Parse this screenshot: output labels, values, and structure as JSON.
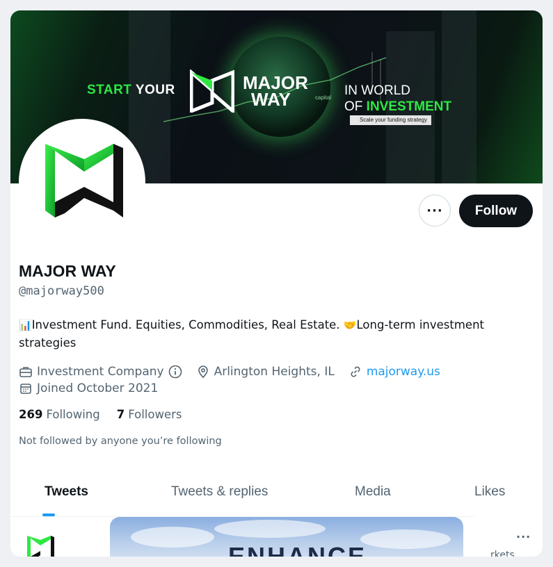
{
  "banner": {
    "start": "START",
    "your": " YOUR",
    "brand_line1": "MAJOR",
    "brand_line2": "WAY",
    "brand_small": "capital",
    "world_line1": "IN WORLD",
    "world_line2_a": "OF ",
    "world_line2_b": "INVESTMENT",
    "tagline": "Scale your funding strategy"
  },
  "actions": {
    "more_label": "···",
    "follow_label": "Follow"
  },
  "profile": {
    "display_name": "MAJOR WAY",
    "handle": "@majorway500",
    "bio_chart_emoji": "📊",
    "bio_part1": "Investment Fund. Equities, Commodities, Real Estate. ",
    "bio_handshake_emoji": "🤝",
    "bio_part2": "Long-term investment strategies",
    "category": "Investment Company",
    "location": "Arlington Heights, IL",
    "website": "majorway.us",
    "joined": "Joined October 2021",
    "following_count": "269",
    "following_label": "Following",
    "followers_count": "7",
    "followers_label": "Followers",
    "not_followed": "Not followed by anyone you’re following"
  },
  "tabs": [
    {
      "label": "Tweets",
      "active": true
    },
    {
      "label": "Tweets & replies",
      "active": false
    },
    {
      "label": "Media",
      "active": false
    },
    {
      "label": "Likes",
      "active": false
    }
  ],
  "tweet_preview": {
    "image_headline": "ENHANCE",
    "more_label": "···",
    "side_text": "rkets"
  },
  "colors": {
    "brand_green": "#2ee843",
    "follow_bg": "#0f1419",
    "link": "#1d9bf0",
    "muted": "#536471"
  }
}
